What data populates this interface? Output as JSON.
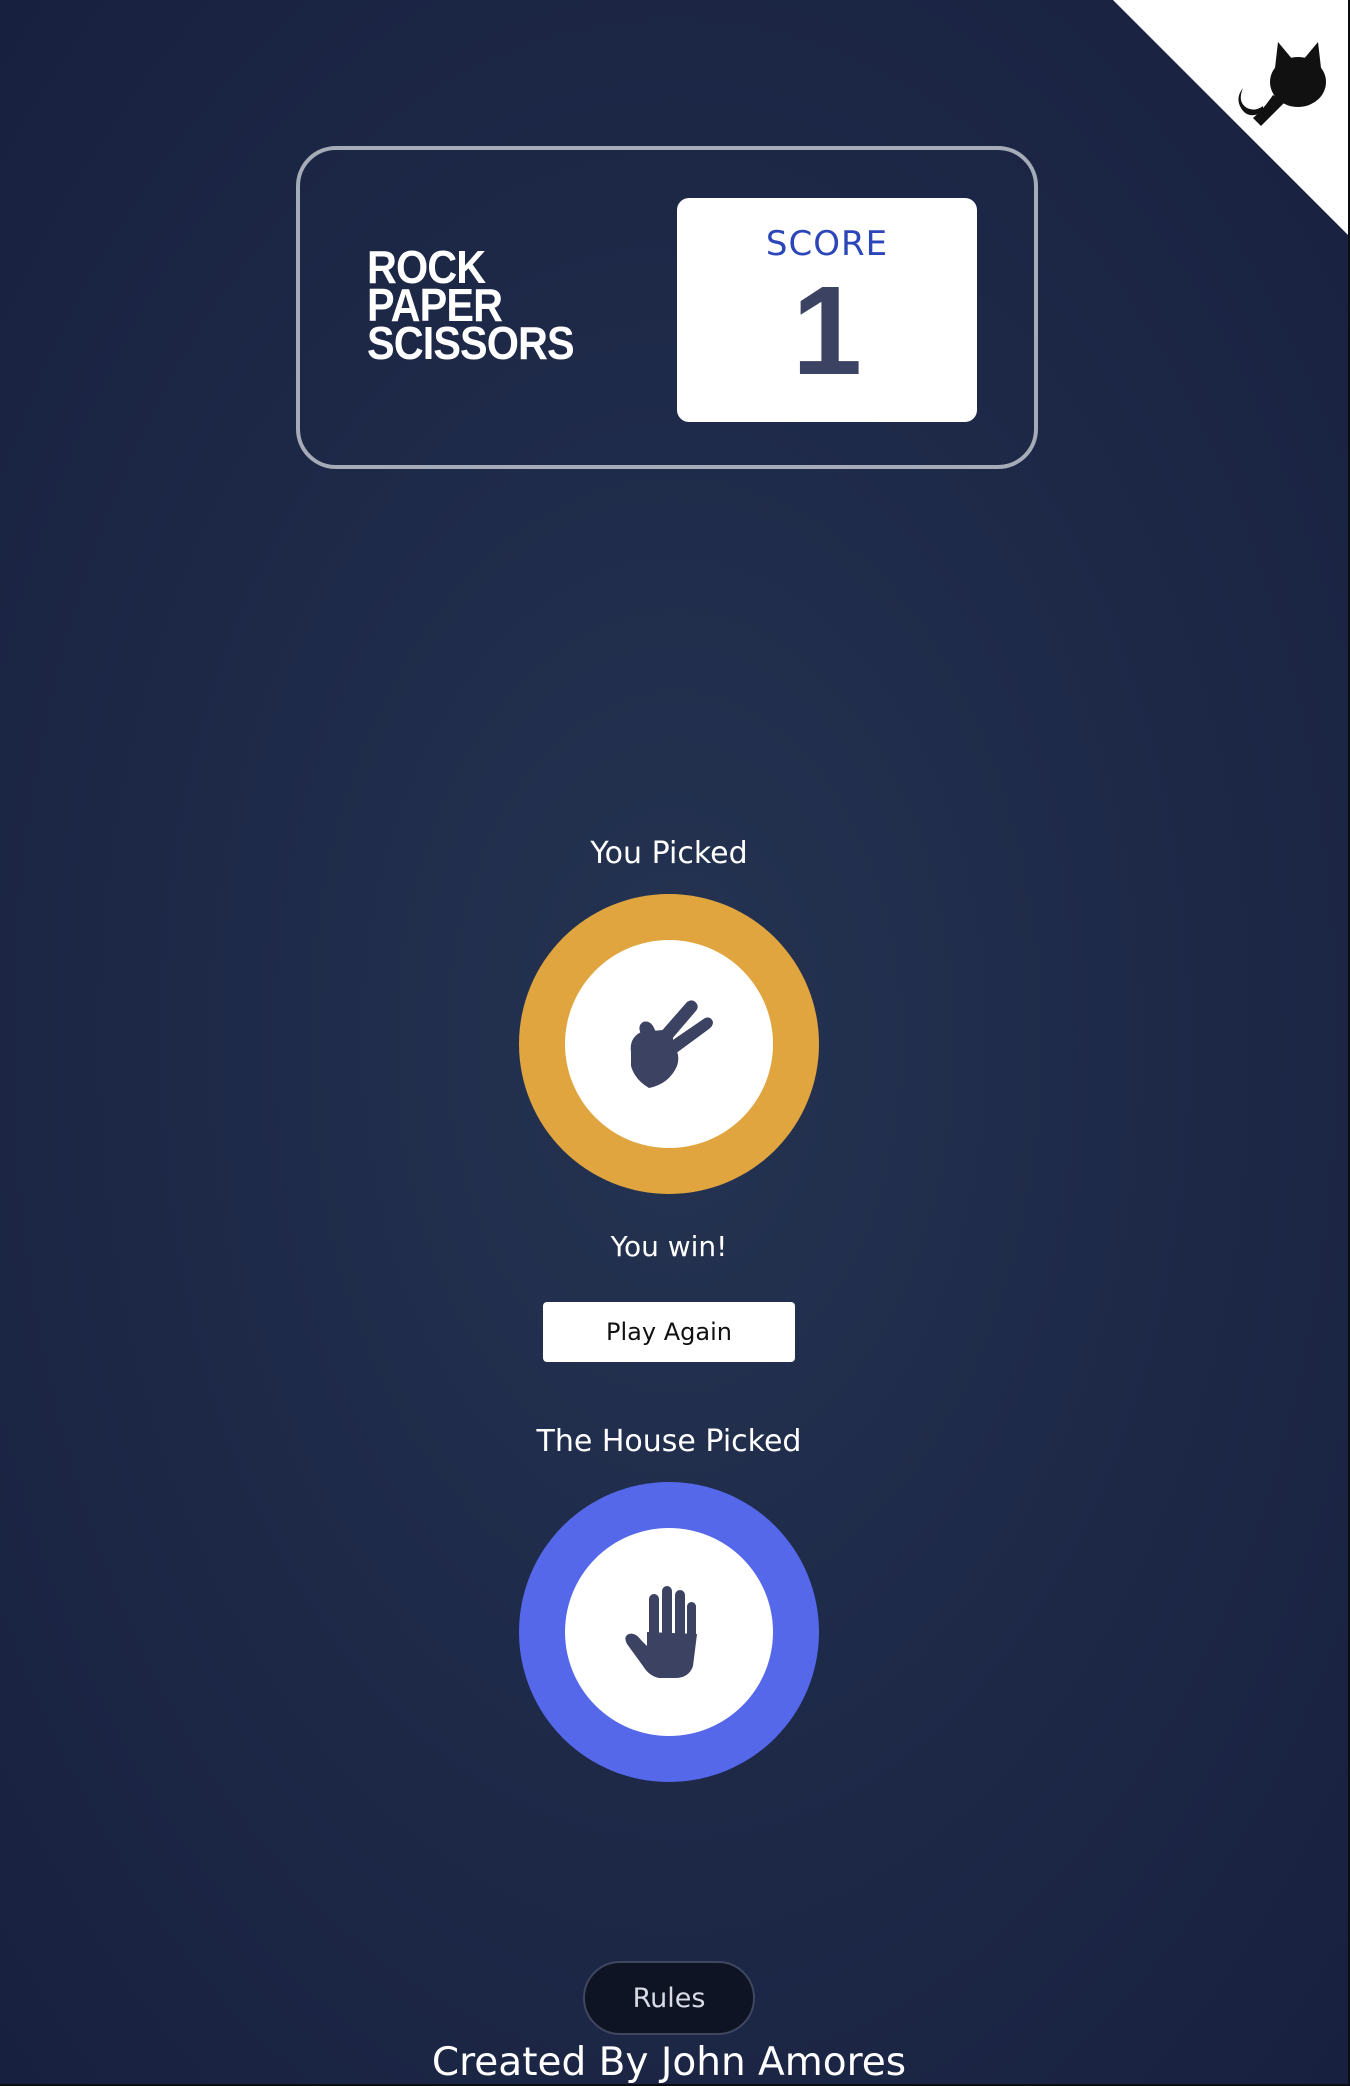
{
  "corner": {
    "icon": "github-octocat-icon",
    "background": "#ffffff",
    "icon_color": "#111111"
  },
  "header": {
    "title_lines": [
      "ROCK",
      "PAPER",
      "SCISSORS"
    ],
    "score_label": "SCORE",
    "score_value": "1"
  },
  "player": {
    "label": "You Picked",
    "choice": "scissors",
    "choice_icon": "scissors-hand-icon",
    "ring_color": "#e1a53f"
  },
  "result": {
    "text": "You win!",
    "play_again_label": "Play Again"
  },
  "house": {
    "label": "The House Picked",
    "choice": "paper",
    "choice_icon": "paper-hand-icon",
    "ring_color": "#5568ea"
  },
  "footer": {
    "rules_label": "Rules",
    "credits": "Created By John Amores"
  },
  "colors": {
    "background": "#1f2b4a",
    "header_border": "#a6abb8",
    "score_label": "#2b46b8",
    "score_value": "#3b4262",
    "hand_icon": "#3b4262"
  }
}
